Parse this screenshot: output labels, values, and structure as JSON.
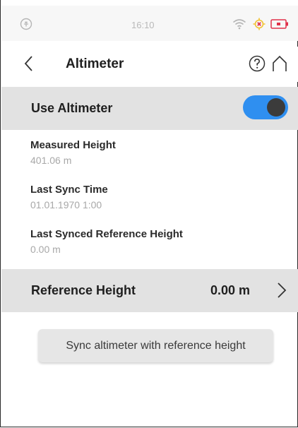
{
  "status_bar": {
    "time": "16:10",
    "icons": [
      "app-icon",
      "wifi-icon",
      "satellite-status-icon",
      "battery-icon"
    ],
    "accent_color": "#e0304a"
  },
  "header": {
    "title": "Altimeter",
    "back_icon": "chevron-left-icon",
    "help_icon": "help-circle-icon",
    "home_icon": "home-icon"
  },
  "use_altimeter": {
    "label": "Use Altimeter",
    "enabled": true,
    "toggle_color": "#2f8ff0"
  },
  "info": [
    {
      "title": "Measured Height",
      "value": "401.06 m"
    },
    {
      "title": "Last Sync Time",
      "value": "01.01.1970 1:00"
    },
    {
      "title": "Last Synced Reference Height",
      "value": "0.00 m"
    }
  ],
  "reference_height": {
    "label": "Reference Height",
    "value": "0.00 m",
    "icon": "chevron-right-icon"
  },
  "sync_button": {
    "label": "Sync altimeter with reference height"
  }
}
